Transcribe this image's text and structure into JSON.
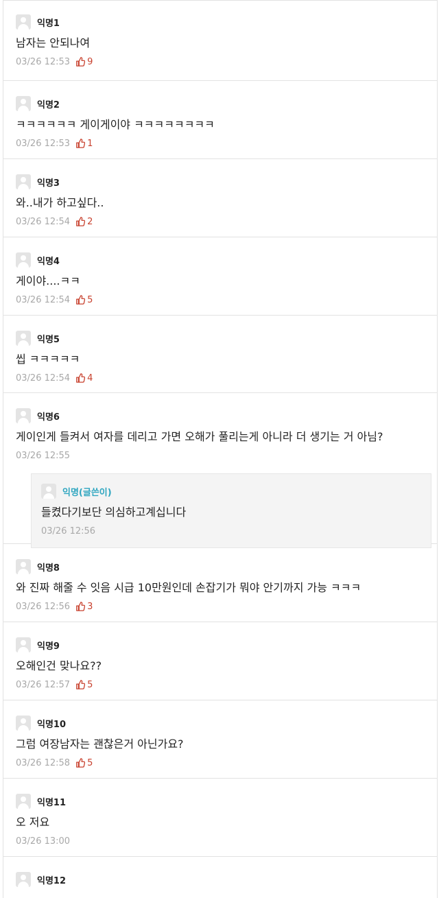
{
  "comments": [
    {
      "nick": "익명1",
      "text": "남자는 안되나여",
      "time": "03/26 12:53",
      "votes": "9"
    },
    {
      "nick": "익명2",
      "text": "ㅋㅋㅋㅋㅋㅋ 게이게이야 ㅋㅋㅋㅋㅋㅋㅋㅋ",
      "time": "03/26 12:53",
      "votes": "1"
    },
    {
      "nick": "익명3",
      "text": "와..내가 하고싶다..",
      "time": "03/26 12:54",
      "votes": "2"
    },
    {
      "nick": "익명4",
      "text": "게이야....ㅋㅋ",
      "time": "03/26 12:54",
      "votes": "5"
    },
    {
      "nick": "익명5",
      "text": "씹 ㅋㅋㅋㅋㅋ",
      "time": "03/26 12:54",
      "votes": "4"
    },
    {
      "nick": "익명6",
      "text": "게이인게 들켜서 여자를 데리고 가면 오해가 풀리는게 아니라 더 생기는 거 아님?",
      "time": "03/26 12:55",
      "reply": {
        "nick": "익명(글쓴이)",
        "text": "들켰다기보단 의심하고계십니다",
        "time": "03/26 12:56"
      }
    },
    {
      "nick": "익명8",
      "text": "와 진짜 해줄 수 잇음 시급 10만원인데 손잡기가 뭐야 안기까지 가능 ㅋㅋㅋ",
      "time": "03/26 12:56",
      "votes": "3"
    },
    {
      "nick": "익명9",
      "text": "오해인건 맞나요??",
      "time": "03/26 12:57",
      "votes": "5"
    },
    {
      "nick": "익명10",
      "text": "그럼 여장남자는 괜찮은거 아닌가요?",
      "time": "03/26 12:58",
      "votes": "5"
    },
    {
      "nick": "익명11",
      "text": "오 저요",
      "time": "03/26 13:00"
    },
    {
      "nick": "익명12"
    }
  ],
  "icons": {
    "avatar": "default-avatar-icon",
    "vote": "thumbs-up-icon"
  },
  "colors": {
    "vote": "#c8412e",
    "reply_nick": "#2fa6c0",
    "meta": "#a8a8a8",
    "border": "#e2e2e2",
    "reply_bg": "#f4f4f4"
  }
}
